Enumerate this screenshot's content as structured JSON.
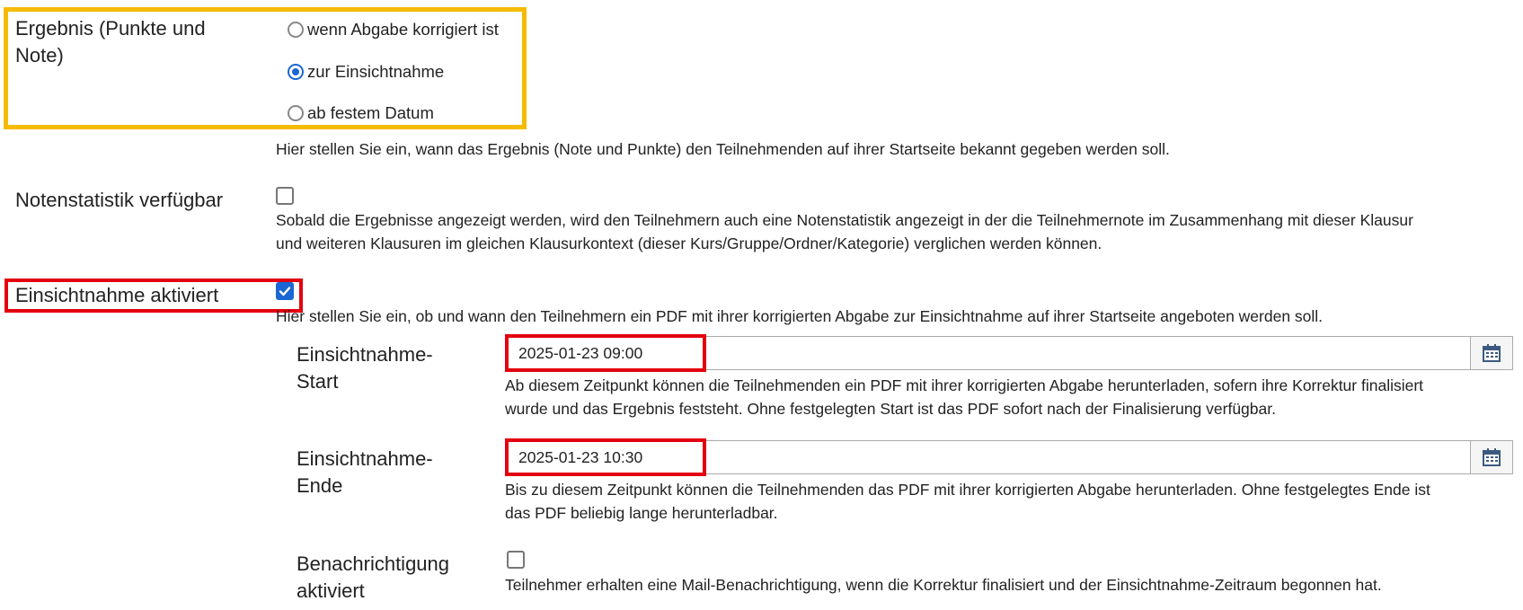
{
  "result": {
    "label": "Ergebnis (Punkte und Note)",
    "options": [
      {
        "label": "wenn Abgabe korrigiert ist",
        "checked": false
      },
      {
        "label": "zur Einsichtnahme",
        "checked": true
      },
      {
        "label": "ab festem Datum",
        "checked": false
      }
    ],
    "help": "Hier stellen Sie ein, wann das Ergebnis (Note und Punkte) den Teilnehmenden auf ihrer Startseite bekannt gegeben werden soll."
  },
  "stats": {
    "label": "Notenstatistik verfügbar",
    "checked": false,
    "help_line1": "Sobald die Ergebnisse angezeigt werden, wird den Teilnehmern auch eine Notenstatistik angezeigt in der die Teilnehmernote im Zusammenhang mit dieser Klausur",
    "help_line2": "und weiteren Klausuren im gleichen Klausurkontext (dieser Kurs/Gruppe/Ordner/Kategorie) verglichen werden können."
  },
  "inspection": {
    "label": "Einsichtnahme aktiviert",
    "checked": true,
    "help": "Hier stellen Sie ein, ob und wann den Teilnehmern ein PDF mit ihrer korrigierten Abgabe zur Einsichtnahme auf ihrer Startseite angeboten werden soll.",
    "start": {
      "label_line1": "Einsichtnahme-",
      "label_line2": "Start",
      "value": "2025-01-23 09:00",
      "help_line1": "Ab diesem Zeitpunkt können die Teilnehmenden ein PDF mit ihrer korrigierten Abgabe herunterladen, sofern ihre Korrektur finalisiert",
      "help_line2": "wurde und das Ergebnis feststeht. Ohne festgelegten Start ist das PDF sofort nach der Finalisierung verfügbar."
    },
    "end": {
      "label_line1": "Einsichtnahme-",
      "label_line2": "Ende",
      "value": "2025-01-23 10:30",
      "help_line1": "Bis zu diesem Zeitpunkt können die Teilnehmenden das PDF mit ihrer korrigierten Abgabe herunterladen. Ohne festgelegtes Ende ist",
      "help_line2": "das PDF beliebig lange herunterladbar."
    },
    "notify": {
      "label_line1": "Benachrichtigung",
      "label_line2": "aktiviert",
      "checked": false,
      "help": "Teilnehmer erhalten eine Mail-Benachrichtigung, wenn die Korrektur finalisiert und der Einsichtnahme-Zeitraum begonnen hat."
    }
  },
  "colors": {
    "highlight_yellow": "#f5bb00",
    "highlight_red": "#e3000f",
    "accent_blue": "#1a66d4"
  }
}
